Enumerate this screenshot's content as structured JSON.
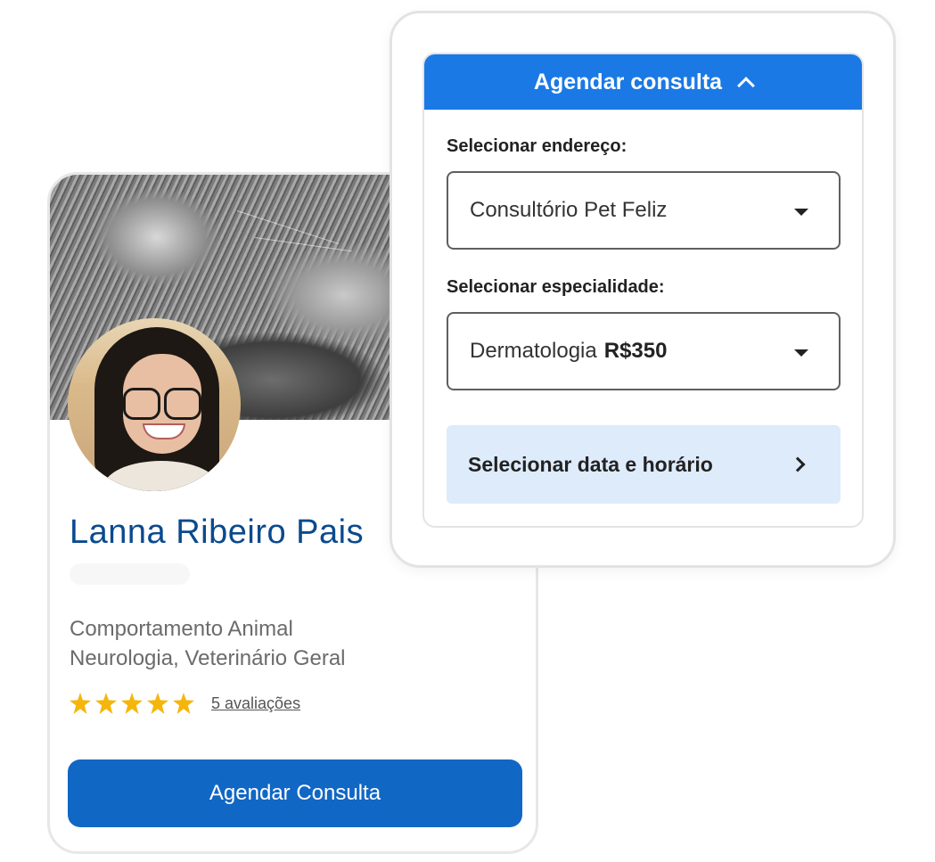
{
  "profile": {
    "name": "Lanna Ribeiro Pais",
    "specialties_line1": "Comportamento Animal",
    "specialties_line2": "Neurologia, Veterinário Geral",
    "rating_stars": 5,
    "reviews_link": "5 avaliações",
    "cta_label": "Agendar Consulta"
  },
  "schedule": {
    "header": "Agendar consulta",
    "address_label": "Selecionar endereço:",
    "address_value": "Consultório Pet Feliz",
    "specialty_label": "Selecionar especialidade:",
    "specialty_value": "Dermatologia",
    "specialty_price": "R$350",
    "date_button": "Selecionar data e horário"
  },
  "colors": {
    "primary": "#1167c4",
    "header_blue": "#1a79e5",
    "name_blue": "#0a4a8e",
    "star": "#f5b50a",
    "date_button_bg": "#ddebfb"
  },
  "icons": [
    "star-icon",
    "chevron-up-icon",
    "caret-down-icon",
    "chevron-right-icon"
  ]
}
